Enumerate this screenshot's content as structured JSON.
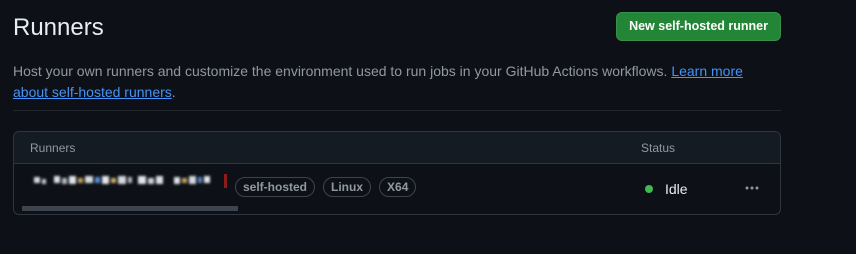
{
  "header": {
    "title": "Runners",
    "new_runner_label": "New self-hosted runner"
  },
  "description": {
    "text": "Host your own runners and customize the environment used to run jobs in your GitHub Actions workflows. ",
    "link_text": "Learn more about self-hosted runners",
    "suffix": "."
  },
  "table": {
    "columns": [
      "Runners",
      "Status"
    ],
    "rows": [
      {
        "name": "",
        "labels": [
          "self-hosted",
          "Linux",
          "X64"
        ],
        "status": "Idle",
        "status_color": "#3fb950"
      }
    ]
  },
  "icons": {
    "more": "kebab-horizontal-icon"
  },
  "colors": {
    "primary_button": "#238636",
    "link": "#4493f8",
    "background": "#0d1117"
  }
}
